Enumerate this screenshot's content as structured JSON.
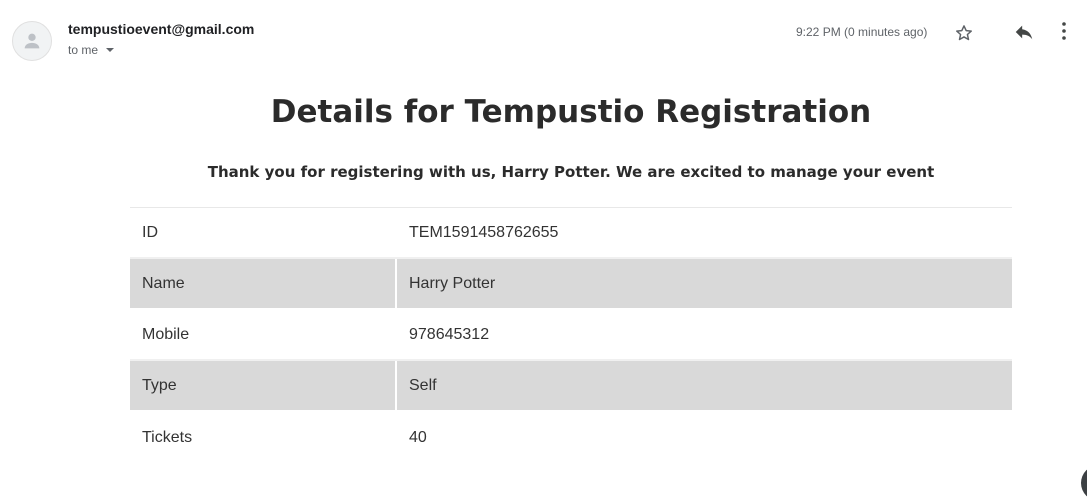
{
  "header": {
    "sender": "tempustioevent@gmail.com",
    "recipient": "to me",
    "timestamp": "9:22 PM (0 minutes ago)",
    "icons": [
      "avatar-icon",
      "star-icon",
      "reply-icon",
      "more-vert-icon"
    ]
  },
  "email": {
    "title": "Details for Tempustio Registration",
    "subtitle": "Thank you for registering with us, Harry Potter. We are excited to manage your event",
    "rows": [
      {
        "label": "ID",
        "value": "TEM1591458762655"
      },
      {
        "label": "Name",
        "value": "Harry Potter"
      },
      {
        "label": "Mobile",
        "value": "978645312"
      },
      {
        "label": "Type",
        "value": "Self"
      },
      {
        "label": "Tickets",
        "value": "40"
      }
    ]
  },
  "colors": {
    "alt_row": "#d9d9d9",
    "text": "#333333",
    "muted": "#5f6368"
  }
}
